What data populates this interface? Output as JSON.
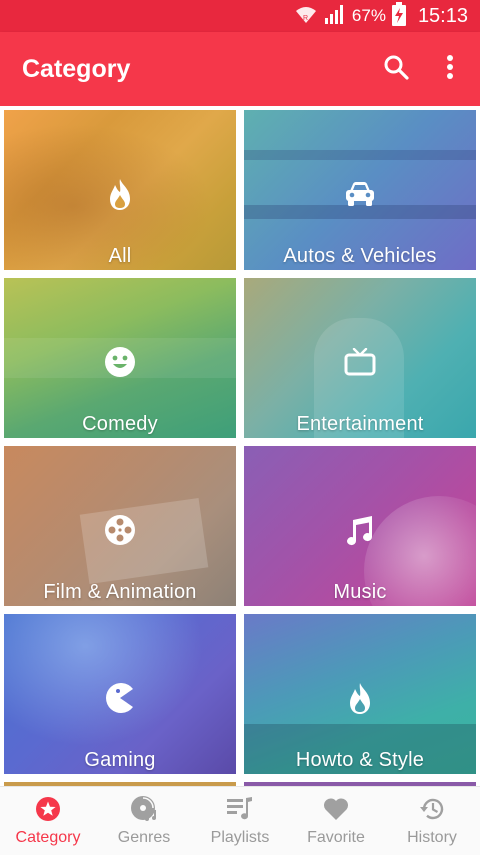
{
  "status_bar": {
    "battery": "67%",
    "time": "15:13"
  },
  "app_bar": {
    "title": "Category",
    "search_icon": "search-icon",
    "menu_icon": "more-vert-icon"
  },
  "colors": {
    "accent": "#f5374a",
    "status_bar": "#e8283e",
    "nav_inactive": "#9a9a9a"
  },
  "categories": [
    {
      "label": "All",
      "icon": "fire-icon"
    },
    {
      "label": "Autos & Vehicles",
      "icon": "car-icon"
    },
    {
      "label": "Comedy",
      "icon": "smiley-icon"
    },
    {
      "label": "Entertainment",
      "icon": "tv-icon"
    },
    {
      "label": "Film & Animation",
      "icon": "film-reel-icon"
    },
    {
      "label": "Music",
      "icon": "music-note-icon"
    },
    {
      "label": "Gaming",
      "icon": "pacman-icon"
    },
    {
      "label": "Howto & Style",
      "icon": "fire-icon"
    }
  ],
  "bottom_nav": {
    "active": "Category",
    "items": [
      {
        "label": "Category",
        "icon": "star-circle-icon"
      },
      {
        "label": "Genres",
        "icon": "disc-icon"
      },
      {
        "label": "Playlists",
        "icon": "playlist-icon"
      },
      {
        "label": "Favorite",
        "icon": "heart-icon"
      },
      {
        "label": "History",
        "icon": "history-icon"
      }
    ]
  }
}
